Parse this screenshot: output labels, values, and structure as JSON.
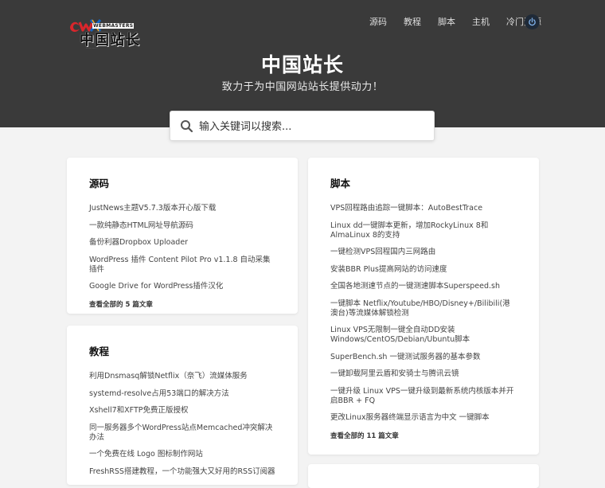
{
  "header": {
    "logo_text": "中国站长",
    "logo_small": "WEBMASTERS",
    "nav": [
      "源码",
      "教程",
      "脚本",
      "主机",
      "冷门资源"
    ],
    "title": "中国站长",
    "subtitle": "致力于为中国网站站长提供动力！"
  },
  "search": {
    "placeholder": "输入关键词以搜索..."
  },
  "cards": {
    "source": {
      "title": "源码",
      "items": [
        "JustNews主题V5.7.3版本开心版下载",
        "一款纯静态HTML网址导航源码",
        "备份利器Dropbox Uploader",
        "WordPress 插件 Content Pilot Pro v1.1.8 自动采集插件",
        "Google Drive for WordPress插件汉化"
      ],
      "more": "查看全部的 5 篇文章"
    },
    "tutorial": {
      "title": "教程",
      "items": [
        "利用Dnsmasq解锁Netflix（奈飞）流媒体服务",
        "systemd-resolve占用53端口的解决方法",
        "Xshell7和XFTP免费正版授权",
        "同一服务器多个WordPress站点Memcached冲突解决办法",
        "一个免费在线 Logo 图标制作网站",
        "FreshRSS搭建教程，一个功能强大又好用的RSS订阅器"
      ]
    },
    "script": {
      "title": "脚本",
      "items": [
        "VPS回程路由追踪一键脚本：AutoBestTrace",
        "Linux dd一键脚本更新，增加RockyLinux 8和AlmaLinux 8的支持",
        "一键检测VPS回程国内三网路由",
        "安装BBR Plus提高网站的访问速度",
        "全国各地测速节点的一键测速脚本Superspeed.sh",
        "一键脚本 Netflix/Youtube/HBO/Disney+/Bilibili(港澳台)等流媒体解锁检测",
        "Linux VPS无限制一键全自动DD安装Windows/CentOS/Debian/Ubuntu脚本",
        "SuperBench.sh 一键测试服务器的基本参数",
        "一键卸载阿里云盾和安骑士与腾讯云镜",
        "一键升级 Linux VPS一键升级到最新系统内核版本并开启BBR + FQ",
        "更改Linux服务器终端显示语言为中文 一键脚本"
      ],
      "more": "查看全部的 11 篇文章"
    }
  },
  "colors": {
    "hero_bg": "#3a3a3a",
    "page_bg": "#f3f3f3",
    "power_bg": "#1f2a38"
  }
}
